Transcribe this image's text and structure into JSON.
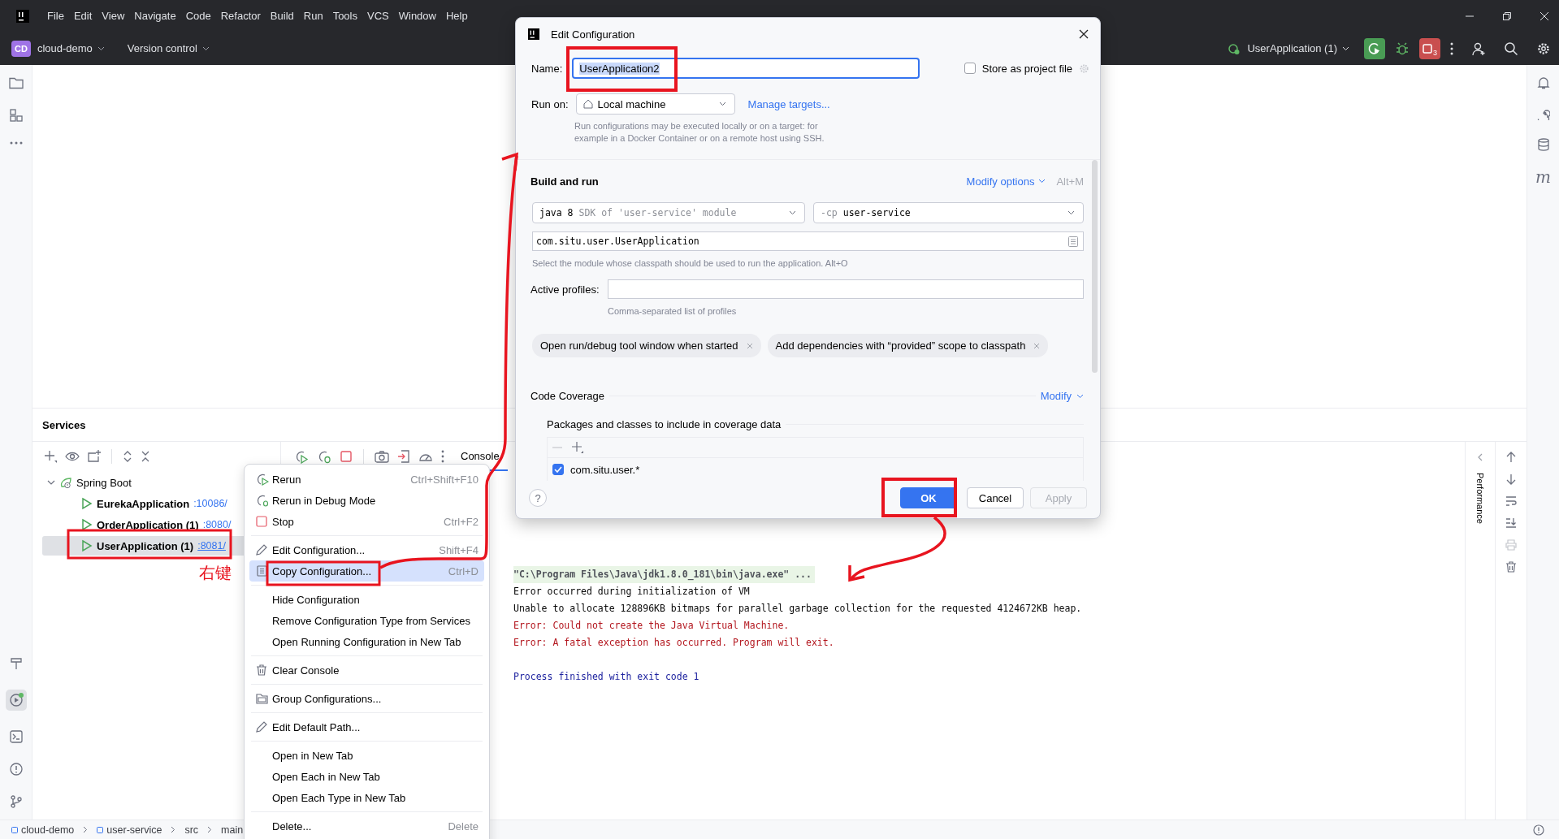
{
  "menu_bar": [
    "File",
    "Edit",
    "View",
    "Navigate",
    "Code",
    "Refactor",
    "Build",
    "Run",
    "Tools",
    "VCS",
    "Window",
    "Help"
  ],
  "toolbar": {
    "project_badge": "CD",
    "project": "cloud-demo",
    "vcs": "Version control",
    "run_config": "UserApplication (1)",
    "stop_badge": "3"
  },
  "right_strip": {
    "maven_label": "m"
  },
  "services": {
    "title": "Services",
    "groups": [
      {
        "label": "Spring Boot",
        "expanded": true,
        "children": [
          {
            "name": "EurekaApplication",
            "port": ":10086/",
            "selected": false
          },
          {
            "name": "OrderApplication (1)",
            "port": ":8080/",
            "selected": false
          },
          {
            "name": "UserApplication (1)",
            "port": ":8081/",
            "selected": true
          }
        ]
      }
    ],
    "console_tab": "Console",
    "console_lines": [
      {
        "kind": "command",
        "text": "\"C:\\Program Files\\Java\\jdk1.8.0_181\\bin\\java.exe\" ..."
      },
      {
        "kind": "stdout",
        "text": "Error occurred during initialization of VM"
      },
      {
        "kind": "stdout",
        "text": "Unable to allocate 128896KB bitmaps for parallel garbage collection for the requested 4124672KB heap."
      },
      {
        "kind": "stderr",
        "text": "Error: Could not create the Java Virtual Machine."
      },
      {
        "kind": "stderr",
        "text": "Error: A fatal exception has occurred. Program will exit."
      },
      {
        "kind": "exit",
        "text": "Process finished with exit code 1"
      }
    ],
    "side_label": "Performance"
  },
  "context_menu": {
    "groups": [
      [
        {
          "kind": "rerun",
          "label": "Rerun",
          "shortcut": "Ctrl+Shift+F10",
          "selected": false
        },
        {
          "kind": "debug",
          "label": "Rerun in Debug Mode",
          "selected": false
        },
        {
          "kind": "stop",
          "label": "Stop",
          "shortcut": "Ctrl+F2",
          "selected": false
        }
      ],
      [
        {
          "kind": "edit",
          "label": "Edit Configuration...",
          "shortcut": "Shift+F4",
          "selected": false
        },
        {
          "kind": "copy",
          "label": "Copy Configuration...",
          "shortcut": "Ctrl+D",
          "selected": true
        }
      ],
      [
        {
          "kind": "none",
          "label": "Hide Configuration",
          "selected": false
        },
        {
          "kind": "none",
          "label": "Remove Configuration Type from Services",
          "selected": false
        },
        {
          "kind": "none",
          "label": "Open Running Configuration in New Tab",
          "selected": false
        }
      ],
      [
        {
          "kind": "trash",
          "label": "Clear Console",
          "selected": false
        }
      ],
      [
        {
          "kind": "group",
          "label": "Group Configurations...",
          "selected": false
        }
      ],
      [
        {
          "kind": "edit",
          "label": "Edit Default Path...",
          "selected": false
        }
      ],
      [
        {
          "kind": "none",
          "label": "Open in New Tab",
          "selected": false
        },
        {
          "kind": "none",
          "label": "Open Each in New Tab",
          "selected": false
        },
        {
          "kind": "none",
          "label": "Open Each Type in New Tab",
          "selected": false
        }
      ],
      [
        {
          "kind": "none",
          "label": "Delete...",
          "shortcut": "Delete",
          "selected": false
        }
      ]
    ]
  },
  "dialog": {
    "title": "Edit Configuration",
    "name": {
      "label": "Name:",
      "value": "UserApplication2"
    },
    "store_as_project_file": {
      "label": "Store as project file",
      "checked": false
    },
    "run_on": {
      "label": "Run on:",
      "value": "Local machine",
      "link": "Manage targets..."
    },
    "run_on_hint": "Run configurations may be executed locally or on a target: for example in a Docker Container or on a remote host using SSH.",
    "build_and_run": {
      "title": "Build and run",
      "modify": "Modify options",
      "shortcut": "Alt+M",
      "jdk": {
        "value": "java 8",
        "detail": "SDK of 'user-service' module"
      },
      "classpath": {
        "prefix": "-cp",
        "value": "user-service"
      },
      "main_class": "com.situ.user.UserApplication",
      "main_class_hint": "Select the module whose classpath should be used to run the application. Alt+O",
      "active_profiles": {
        "label": "Active profiles:",
        "hint": "Comma-separated list of profiles"
      },
      "options": [
        "Open run/debug tool window when started",
        "Add dependencies with “provided” scope to classpath"
      ]
    },
    "code_coverage": {
      "title": "Code Coverage",
      "modify": "Modify",
      "packages_title": "Packages and classes to include in coverage data",
      "patterns": [
        {
          "pattern": "com.situ.user.*",
          "checked": true
        }
      ]
    },
    "help": "?",
    "buttons": [
      {
        "label": "OK",
        "kind": "primary"
      },
      {
        "label": "Cancel",
        "kind": "normal"
      },
      {
        "label": "Apply",
        "kind": "disabled"
      }
    ]
  },
  "status_bar": {
    "breadcrumbs": [
      "cloud-demo",
      "user-service",
      "src",
      "main"
    ]
  },
  "annotation": {
    "note": "右键"
  }
}
